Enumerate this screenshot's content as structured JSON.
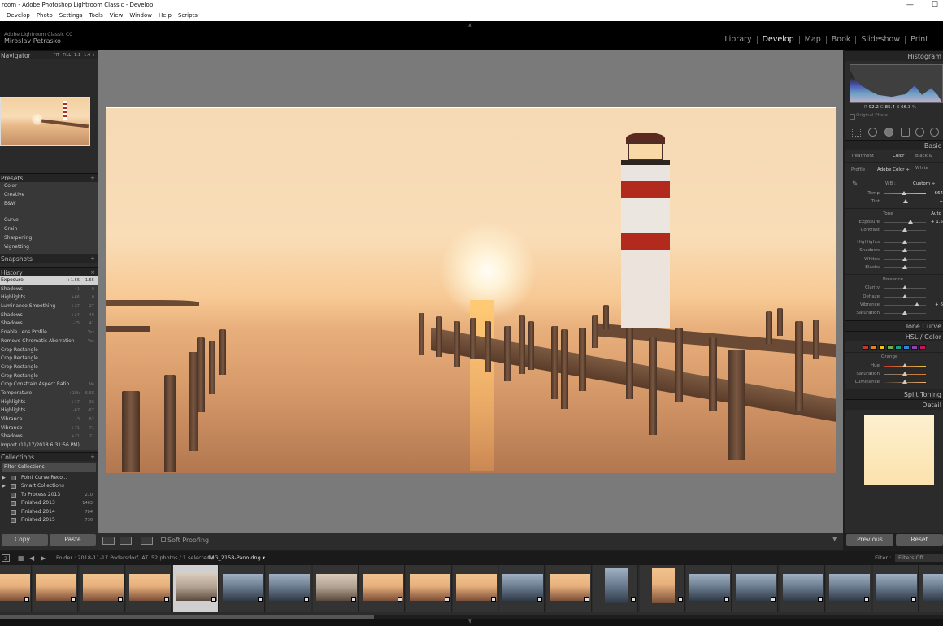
{
  "window": {
    "title": "room - Adobe Photoshop Lightroom Classic - Develop",
    "min": "—",
    "max": "☐"
  },
  "menu": [
    "Develop",
    "Photo",
    "Settings",
    "Tools",
    "View",
    "Window",
    "Help",
    "Scripts"
  ],
  "identity": {
    "sub": "Adobe Lightroom Classic CC",
    "name": "Miroslav Petrasko"
  },
  "modules": [
    {
      "label": "Library",
      "active": false
    },
    {
      "label": "Develop",
      "active": true
    },
    {
      "label": "Map",
      "active": false
    },
    {
      "label": "Book",
      "active": false
    },
    {
      "label": "Slideshow",
      "active": false
    },
    {
      "label": "Print",
      "active": false
    }
  ],
  "navigator": {
    "title": "Navigator",
    "opts": [
      "FIT",
      "FILL",
      "1:1",
      "1:4 ⇕"
    ]
  },
  "presets": {
    "title": "Presets",
    "plus": "+",
    "groups1": [
      "Color",
      "Creative",
      "B&W"
    ],
    "groups2": [
      "Curve",
      "Grain",
      "Sharpening",
      "Vignetting"
    ]
  },
  "snapshots": {
    "title": "Snapshots",
    "plus": "+"
  },
  "history": {
    "title": "History",
    "close": "×",
    "items": [
      {
        "label": "Exposure",
        "v1": "+1.55",
        "v2": "1.55",
        "sel": true
      },
      {
        "label": "Shadows",
        "v1": "-41",
        "v2": "0"
      },
      {
        "label": "Highlights",
        "v1": "+66",
        "v2": "0"
      },
      {
        "label": "Luminance Smoothing",
        "v1": "+27",
        "v2": "27"
      },
      {
        "label": "Shadows",
        "v1": "+24",
        "v2": "49"
      },
      {
        "label": "Shadows",
        "v1": "-25",
        "v2": "41"
      },
      {
        "label": "Enable Lens Profile",
        "v1": "",
        "v2": "Yes"
      },
      {
        "label": "Remove Chromatic Aberration",
        "v1": "",
        "v2": "Yes"
      },
      {
        "label": "Crop Rectangle",
        "v1": "",
        "v2": ""
      },
      {
        "label": "Crop Rectangle",
        "v1": "",
        "v2": ""
      },
      {
        "label": "Crop Rectangle",
        "v1": "",
        "v2": ""
      },
      {
        "label": "Crop Rectangle",
        "v1": "",
        "v2": ""
      },
      {
        "label": "Crop Constrain Aspect Ratio",
        "v1": "",
        "v2": "No"
      },
      {
        "label": "Temperature",
        "v1": "+10k",
        "v2": "6.6K"
      },
      {
        "label": "Highlights",
        "v1": "+17",
        "v2": "-36"
      },
      {
        "label": "Highlights",
        "v1": "-67",
        "v2": "-67"
      },
      {
        "label": "Vibrance",
        "v1": "-3",
        "v2": "62"
      },
      {
        "label": "Vibrance",
        "v1": "+71",
        "v2": "71"
      },
      {
        "label": "Shadows",
        "v1": "+21",
        "v2": "21"
      },
      {
        "label": "Import (11/17/2018 6:31:56 PM)",
        "v1": "",
        "v2": ""
      }
    ]
  },
  "collections": {
    "title": "Collections",
    "plus": "+",
    "filter": "Filter Collections",
    "items": [
      {
        "label": "Point Curve Reco...",
        "arrow": "▶",
        "count": ""
      },
      {
        "label": "Smart Collections",
        "arrow": "▶",
        "count": ""
      },
      {
        "label": "To Process 2013",
        "arrow": "",
        "count": "210"
      },
      {
        "label": "Finished 2013",
        "arrow": "",
        "count": "1463"
      },
      {
        "label": "Finished 2014",
        "arrow": "",
        "count": "784"
      },
      {
        "label": "Finished 2015",
        "arrow": "",
        "count": "730"
      }
    ]
  },
  "left_buttons": {
    "copy": "Copy...",
    "paste": "Paste"
  },
  "toolbar": {
    "soft_proofing": "Soft Proofing",
    "arrow": "▼"
  },
  "histogram": {
    "title": "Histogram",
    "r_label": "R",
    "r": "92.2",
    "g_label": "G",
    "g": "85.4",
    "b_label": "B",
    "b": "66.3",
    "pct": "%",
    "original": "Original Photo"
  },
  "basic": {
    "title": "Basic",
    "treatment_label": "Treatment :",
    "treatment_color": "Color",
    "treatment_bw": "Black & White",
    "profile_label": "Profile :",
    "profile": "Adobe Color ÷",
    "wb_label": "WB :",
    "wb": "Custom ÷",
    "temp_label": "Temp",
    "temp": "664",
    "tint_label": "Tint",
    "tint": "+",
    "tone": "Tone",
    "auto": "Auto",
    "exposure_label": "Exposure",
    "exposure": "+ 1.5",
    "contrast_label": "Contrast",
    "highlights_label": "Highlights",
    "shadows_label": "Shadows",
    "whites_label": "Whites",
    "blacks_label": "Blacks",
    "presence": "Presence",
    "clarity_label": "Clarity",
    "dehaze_label": "Dehaze",
    "vibrance_label": "Vibrance",
    "vibrance": "+ 6",
    "saturation_label": "Saturation"
  },
  "tone_curve": {
    "title": "Tone Curve"
  },
  "hsl": {
    "title": "HSL / Color",
    "group": "Orange",
    "hue": "Hue",
    "saturation": "Saturation",
    "luminance": "Luminance",
    "swatches": [
      "#c0392b",
      "#e67e22",
      "#f1c40f",
      "#6ab04c",
      "#16a085",
      "#2e86de",
      "#8e44ad",
      "#c2185b"
    ]
  },
  "split_toning": {
    "title": "Split Toning"
  },
  "detail": {
    "title": "Detail"
  },
  "right_buttons": {
    "previous": "Previous",
    "reset": "Reset"
  },
  "filmstrip_head": {
    "page": "2",
    "folder": "Folder : 2018-11-17 Podersdorf, AT",
    "count": "52 photos / 1 selected / ",
    "file": "IMG_2158-Pano.dng ▾",
    "filter_label": "Filter :",
    "filter": "Filters Off"
  },
  "filmstrip": {
    "thumbs": [
      {
        "kind": "warm"
      },
      {
        "kind": "warm"
      },
      {
        "kind": "warm"
      },
      {
        "kind": "warm"
      },
      {
        "kind": "grey",
        "sel": true
      },
      {
        "kind": "blue"
      },
      {
        "kind": "blue"
      },
      {
        "kind": "grey"
      },
      {
        "kind": "warm"
      },
      {
        "kind": "warm"
      },
      {
        "kind": "warm"
      },
      {
        "kind": "blue"
      },
      {
        "kind": "warm"
      },
      {
        "kind": "blue",
        "tall": true
      },
      {
        "kind": "warm",
        "tall": true
      },
      {
        "kind": "blue"
      },
      {
        "kind": "blue"
      },
      {
        "kind": "blue"
      },
      {
        "kind": "blue"
      },
      {
        "kind": "blue"
      },
      {
        "kind": "blue"
      }
    ]
  }
}
